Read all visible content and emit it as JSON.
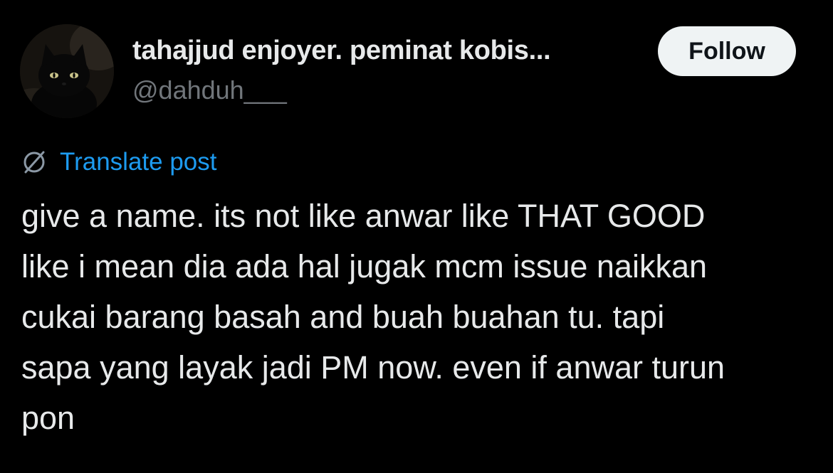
{
  "author": {
    "display_name": "tahajjud enjoyer. peminat kobis...",
    "handle": "@dahduh___",
    "avatar_icon": "black-cat-avatar-icon"
  },
  "follow_button": {
    "label": "Follow"
  },
  "translate": {
    "icon": "globe-slash-icon",
    "label": "Translate post"
  },
  "post": {
    "lines": [
      "give a name. its not like anwar like THAT GOOD",
      "like i mean dia ada hal jugak mcm issue naikkan",
      "cukai barang basah and buah buahan tu. tapi",
      "sapa yang layak jadi PM now. even if anwar turun",
      "pon"
    ]
  },
  "colors": {
    "background": "#000000",
    "text_primary": "#e7e9ea",
    "text_secondary": "#71767b",
    "link": "#1d9bf0",
    "button_bg": "#eff3f4",
    "button_text": "#0f1419"
  }
}
